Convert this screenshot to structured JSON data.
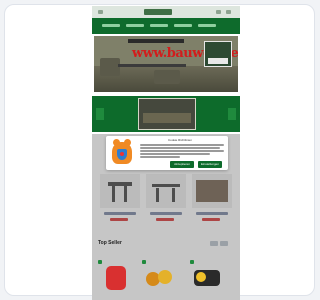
{
  "hero": {
    "brand_text": "www.bauwos.de"
  },
  "cookie_dialog": {
    "title": "Cookie Richtlinien",
    "accept_label": "Akzeptieren",
    "settings_label": "Einstellungen"
  },
  "sections": {
    "top_sellers": "Top Seller"
  },
  "colors": {
    "nav_green": "#0e6b2c",
    "brand_red": "#d21c1c",
    "cookie_orange": "#f08a24"
  }
}
